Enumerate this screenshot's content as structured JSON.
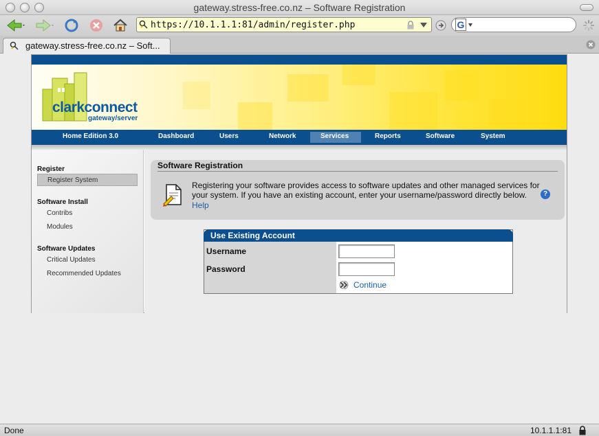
{
  "window": {
    "title": "gateway.stress-free.co.nz – Software Registration"
  },
  "toolbar": {
    "url": "https://10.1.1.1:81/admin/register.php",
    "search_engine_letter": "G"
  },
  "tab": {
    "label": "gateway.stress-free.co.nz – Soft..."
  },
  "banner": {
    "logo_word": "clarkconnect",
    "logo_sub": "gateway/server",
    "colors": {
      "nav": "#0b4f8e",
      "active_nav": "#4f81b2",
      "banner_yellow": "#ffdc10"
    }
  },
  "nav": {
    "edition": "Home Edition 3.0",
    "items": [
      "Dashboard",
      "Users",
      "Network",
      "Services",
      "Reports",
      "Software",
      "System"
    ],
    "active": "Services"
  },
  "sidebar": {
    "sections": [
      {
        "heading": "Register",
        "items": [
          {
            "label": "Register System",
            "active": true
          }
        ]
      },
      {
        "heading": "Software Install",
        "items": [
          {
            "label": "Contribs"
          },
          {
            "label": "Modules"
          }
        ]
      },
      {
        "heading": "Software Updates",
        "items": [
          {
            "label": "Critical Updates"
          },
          {
            "label": "Recommended Updates"
          }
        ]
      }
    ]
  },
  "registration": {
    "title": "Software Registration",
    "text": "Registering your software provides access to software updates and other managed services for your system. If you have an existing account, enter your username/password directly below.",
    "help": "Help"
  },
  "account": {
    "heading": "Use Existing Account",
    "username_label": "Username",
    "password_label": "Password",
    "username_value": "",
    "password_value": "",
    "continue": "Continue"
  },
  "status": {
    "left": "Done",
    "right": "10.1.1.1:81"
  }
}
